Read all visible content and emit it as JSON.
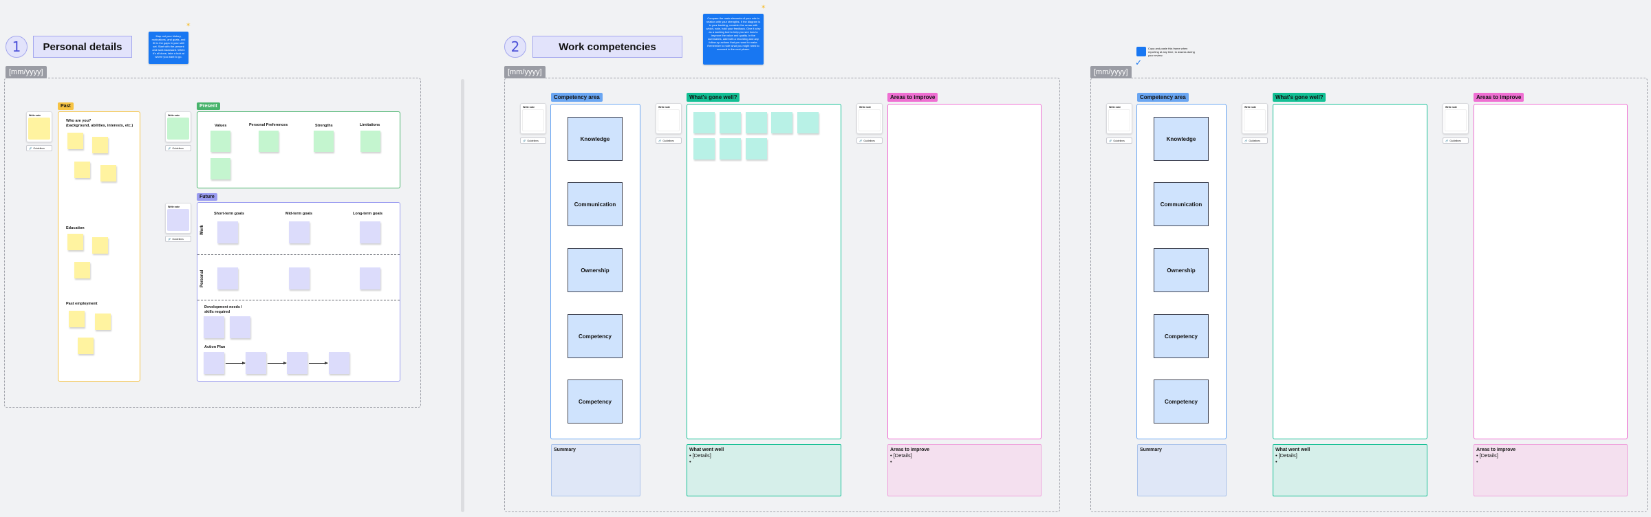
{
  "section1": {
    "number": "1",
    "title": "Personal details",
    "date_tag": "[mm/yyyy]",
    "blue_note": "Map out your history, motivations, and goals, and fill in the gaps in your skill set. Start with the present and work backward. When it's all done, take a look at where you want to go.",
    "card_label": "Write note",
    "chip_label": "Guidelines",
    "past_label": "Past",
    "present_label": "Present",
    "future_label": "Future",
    "who_are_you": "Who are you?",
    "who_are_you_sub": "(background, abilities, interests, etc.)",
    "education": "Education",
    "past_employment": "Past employment",
    "present_headers": [
      "Values",
      "Personal Preferences",
      "Strengths",
      "Limitations"
    ],
    "future_headers": [
      "Short-term goals",
      "Mid-term goals",
      "Long-term goals"
    ],
    "row_work": "Work",
    "row_personal": "Personal",
    "dev_needs": "Development needs / skills required",
    "action_plan": "Action Plan"
  },
  "section2": {
    "number": "2",
    "title": "Work competencies",
    "date_tag": "[mm/yyyy]",
    "blue_note": "Compare the main elements of your role in relation with your strengths. If the diagram is in your tracking, consider the areas with which, note, hold your feedback. Give it a try as a working tool to help you see how to improve the value and quality. In the summaries, add both a recording and any follow-up actions that you want to make. Remember to note what you might need to succeed in the next phase.",
    "copy_note": "Copy and paste this frame when reporting at any time, to assess during your review.",
    "competency_area": "Competency area",
    "gone_well": "What's gone well?",
    "areas_to_improve": "Areas to improve",
    "card_label": "Write note",
    "chip_label": "Guidelines",
    "competencies": [
      "Knowledge",
      "Communication",
      "Ownership",
      "Competency",
      "Competency"
    ],
    "summary_title": "Summary",
    "what_went_well": "What went well",
    "details_bullet": "[Details]",
    "areas_to_improve_summary": "Areas to improve"
  },
  "colors": {
    "accent_blue": "#1877f2",
    "past_yellow": "#f6c343",
    "present_green": "#47b36b",
    "future_purple": "#9a9cf0",
    "competency_blue": "#6aa6f2",
    "gone_well_teal": "#13bf94",
    "improve_pink": "#ef6fd2"
  }
}
